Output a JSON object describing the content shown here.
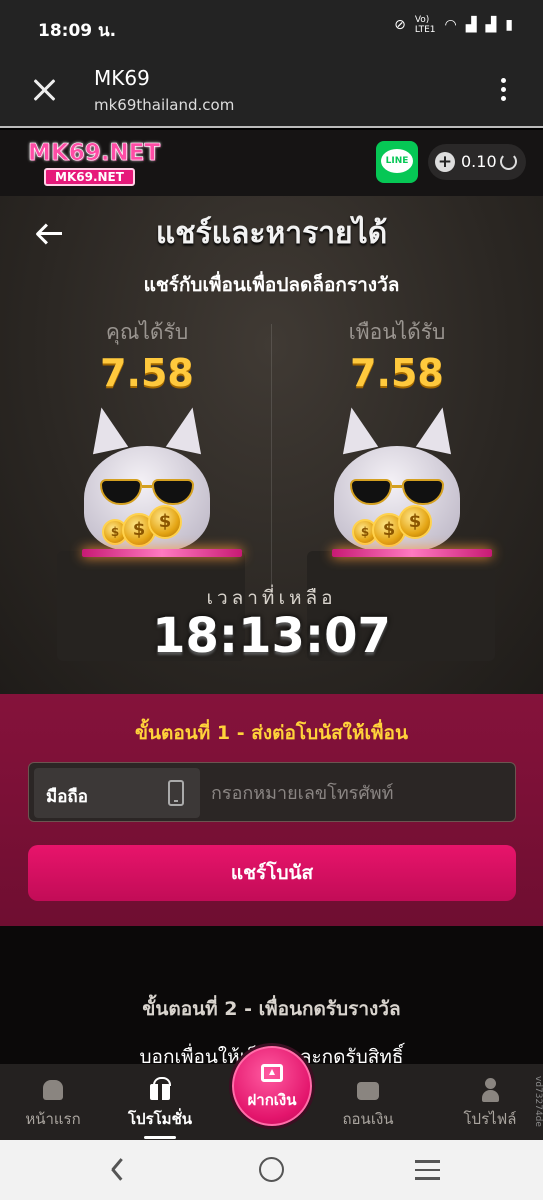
{
  "status_bar": {
    "time": "18:09 น.",
    "icons": [
      "mute-icon",
      "volte-icon",
      "wifi-icon",
      "signal-icon",
      "signal-icon",
      "battery-icon"
    ]
  },
  "browser": {
    "title": "MK69",
    "url": "mk69thailand.com"
  },
  "header": {
    "logo_main": "MK69.NET",
    "logo_sub": "MK69.NET",
    "line_label": "LINE",
    "balance": "0.10"
  },
  "promo": {
    "title": "แชร์และหารายได้",
    "subtitle": "แชร์กับเพื่อนเพื่อปลดล็อกรางวัล",
    "you_receive_label": "คุณได้รับ",
    "you_receive_amount": "7.58",
    "friend_receive_label": "เพือนได้รับ",
    "friend_receive_amount": "7.58",
    "coin_symbol": "$",
    "time_left_label": "เวลาที่เหลือ",
    "time_left": "18:13:07"
  },
  "step1": {
    "title": "ขั้นตอนที่ 1 - ส่งต่อโบนัสให้เพื่อน",
    "phone_prefix": "มือถือ",
    "phone_placeholder": "กรอกหมายเลขโทรศัพท์",
    "phone_value": "",
    "share_button": "แชร์โบนัส"
  },
  "step2": {
    "title": "ขั้นตอนที่ 2 - เพื่อนกดรับรางวัล",
    "text": "บอกเพื่อนให้เล็...ลและกดรับสิทธิ์"
  },
  "bottom_nav": {
    "items": [
      {
        "label": "หน้าแรก",
        "icon": "home-icon"
      },
      {
        "label": "โปรโมชั่น",
        "icon": "gift-icon",
        "active": true
      },
      {
        "label": "ฝากเงิน",
        "icon": "deposit-icon"
      },
      {
        "label": "ถอนเงิน",
        "icon": "wallet-icon"
      },
      {
        "label": "โปรไฟล์",
        "icon": "user-icon"
      }
    ]
  },
  "side_tag": "vd73274de",
  "colors": {
    "accent_pink": "#e8146b",
    "gold": "#ffc93d",
    "step1_bg": "#85123b",
    "line_green": "#06c755"
  }
}
